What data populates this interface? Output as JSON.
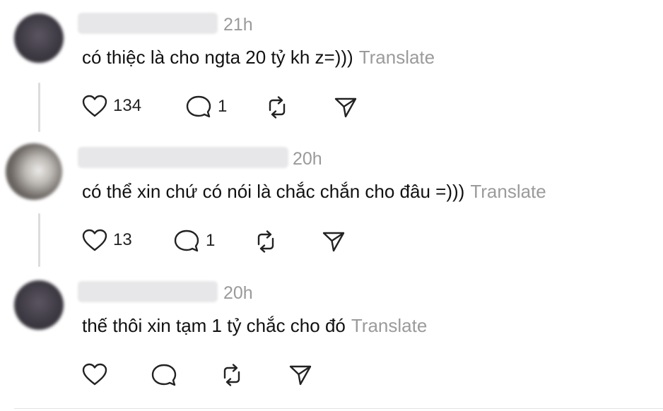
{
  "comments": [
    {
      "time": "21h",
      "text": "có thiệc là cho ngta 20 tỷ kh z=)))",
      "translate": "Translate",
      "likes": "134",
      "replies": "1"
    },
    {
      "time": "20h",
      "text": "có thể xin chứ có nói là chắc chắn cho đâu =)))",
      "translate": "Translate",
      "likes": "13",
      "replies": "1"
    },
    {
      "time": "20h",
      "text": "thế thôi xin tạm 1 tỷ chắc cho đó",
      "translate": "Translate",
      "likes": "",
      "replies": ""
    }
  ],
  "icons": {
    "like": "heart-icon",
    "reply": "comment-bubble-icon",
    "repost": "repost-icon",
    "share": "send-icon"
  }
}
